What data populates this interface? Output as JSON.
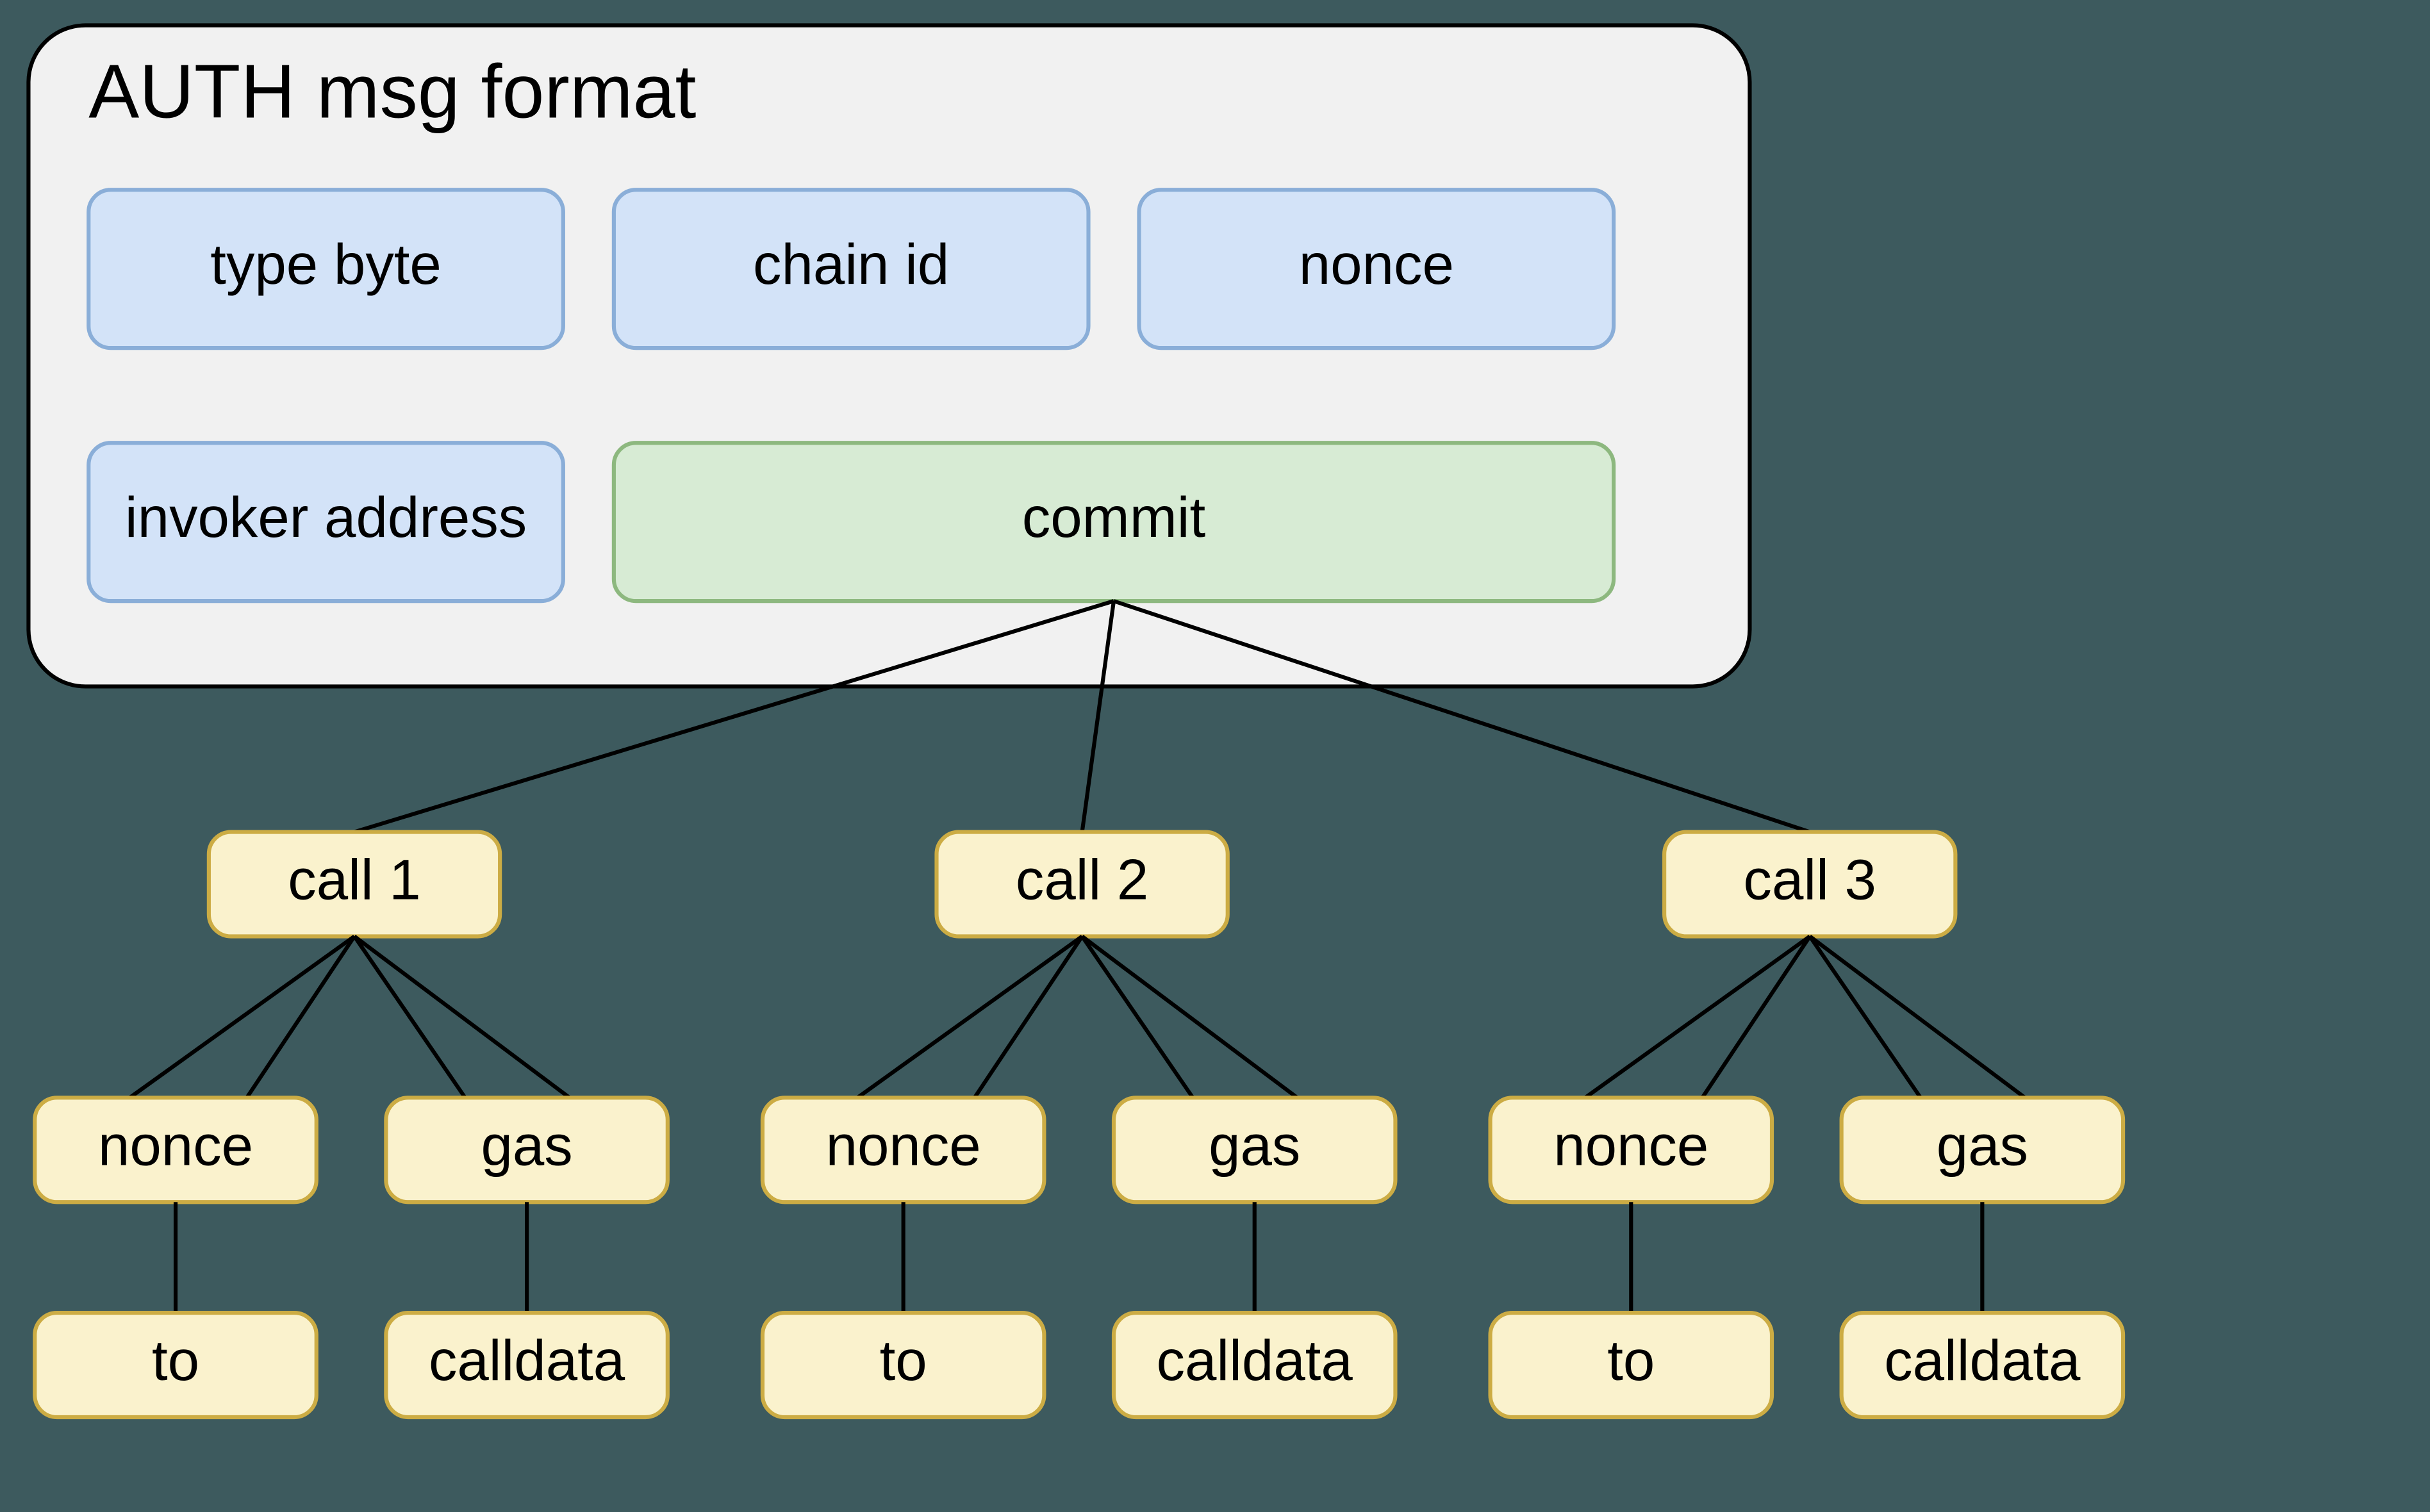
{
  "title": "AUTH msg format",
  "fields": {
    "typeByte": "type byte",
    "chainId": "chain id",
    "nonceField": "nonce",
    "invokerAddress": "invoker address",
    "commit": "commit"
  },
  "calls": [
    {
      "label": "call 1",
      "children": {
        "nonce": "nonce",
        "gas": "gas",
        "to": "to",
        "calldata": "calldata"
      }
    },
    {
      "label": "call 2",
      "children": {
        "nonce": "nonce",
        "gas": "gas",
        "to": "to",
        "calldata": "calldata"
      }
    },
    {
      "label": "call 3",
      "children": {
        "nonce": "nonce",
        "gas": "gas",
        "to": "to",
        "calldata": "calldata"
      }
    }
  ]
}
